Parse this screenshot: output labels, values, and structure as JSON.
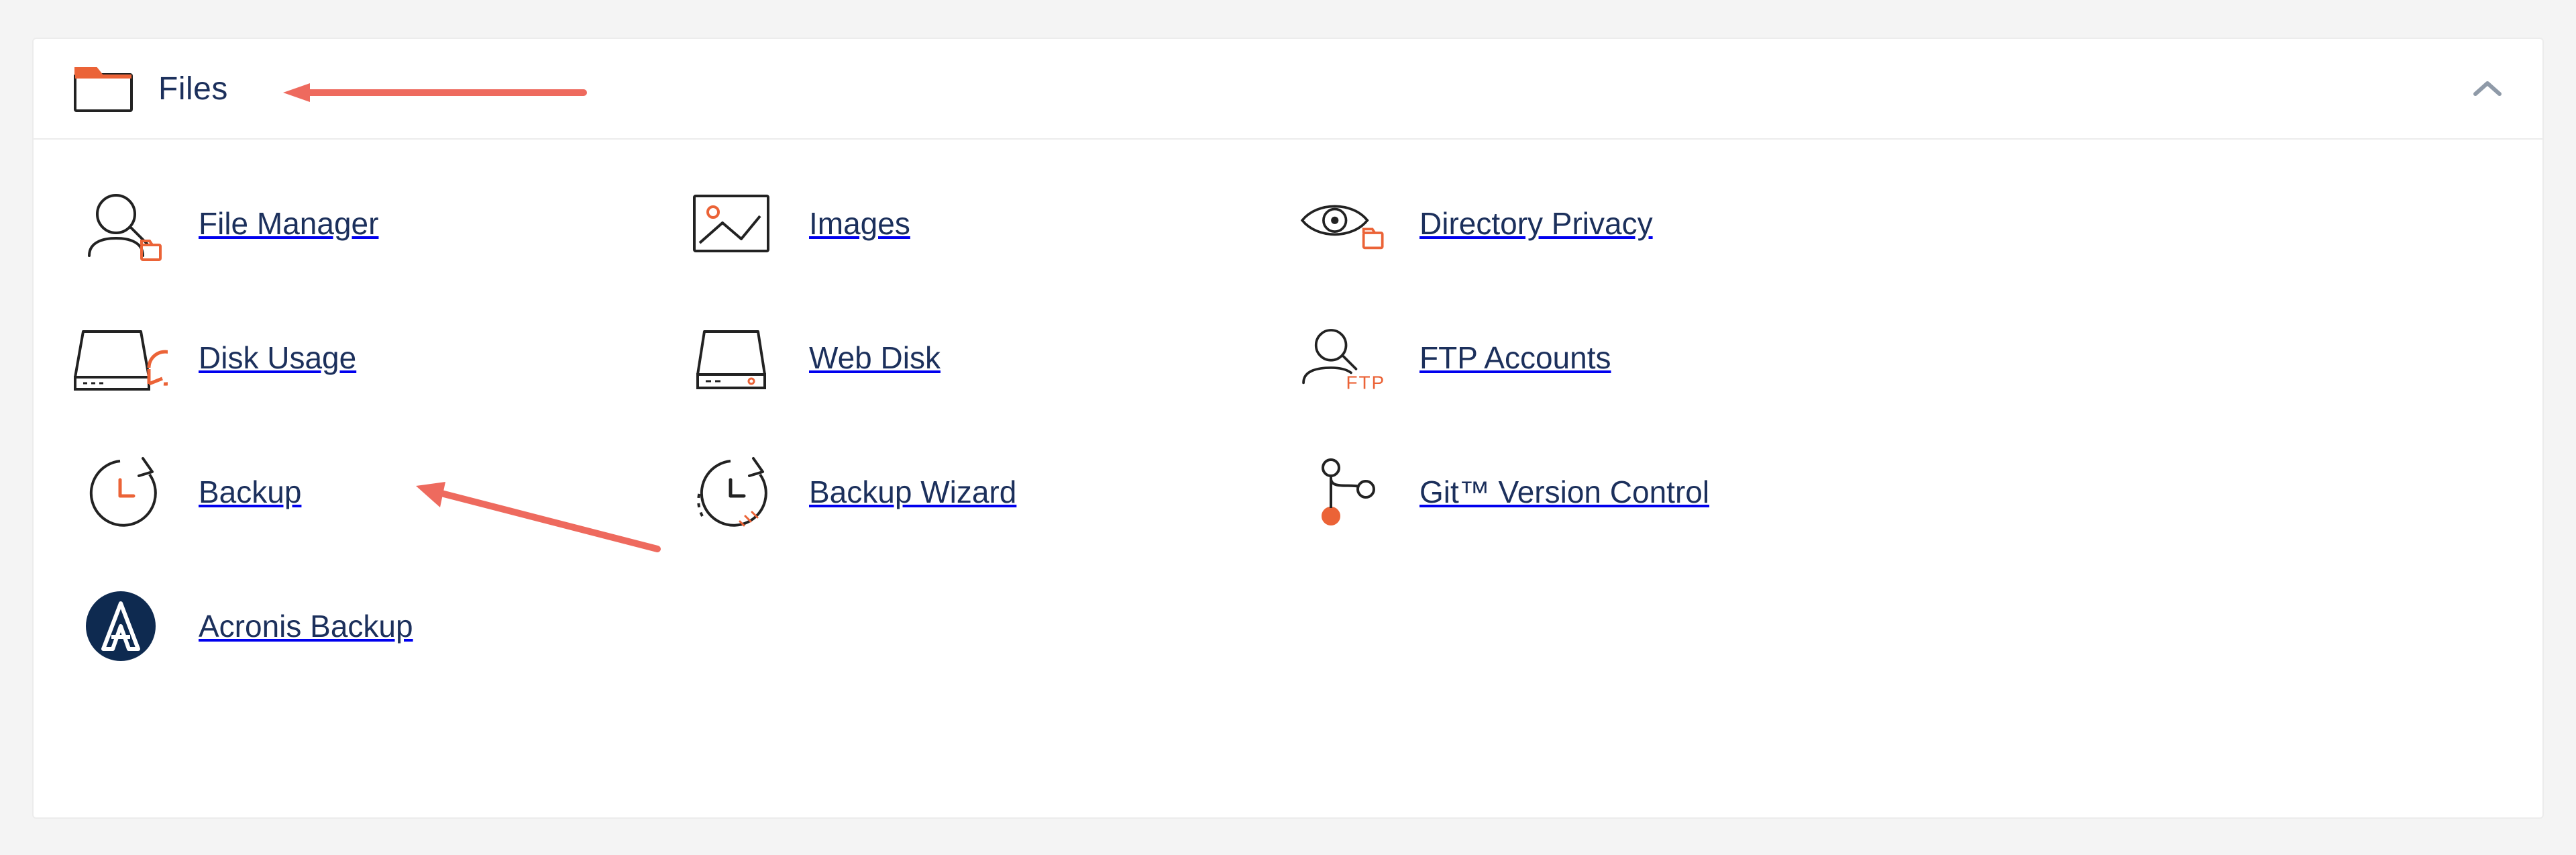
{
  "section": {
    "title": "Files"
  },
  "items": [
    {
      "label": "File Manager"
    },
    {
      "label": "Images"
    },
    {
      "label": "Directory Privacy"
    },
    {
      "label": "Disk Usage"
    },
    {
      "label": "Web Disk"
    },
    {
      "label": "FTP Accounts"
    },
    {
      "label": "Backup"
    },
    {
      "label": "Backup Wizard"
    },
    {
      "label": "Git™ Version Control"
    },
    {
      "label": "Acronis Backup"
    }
  ],
  "colors": {
    "accent": "#eb6337",
    "ink": "#222222",
    "brand": "#1c305c",
    "panel_border": "#ececec",
    "caret": "#8f9aa8",
    "arrow": "#ee6a5e",
    "acronis_bg": "#0e2a50"
  }
}
